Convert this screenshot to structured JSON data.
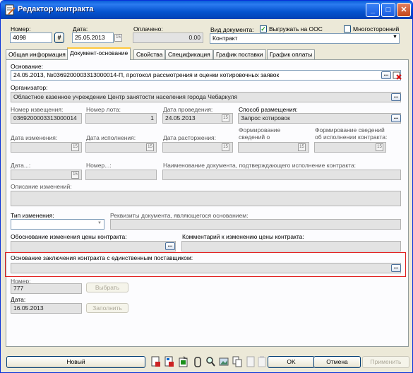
{
  "window": {
    "title": "Редактор контракта",
    "min": "_",
    "max": "□",
    "close": "✕"
  },
  "header": {
    "number_label": "Номер:",
    "number_value": "4098",
    "date_label": "Дата:",
    "date_value": "25.05.2013",
    "paid_label": "Оплачено:",
    "paid_value": "0.00",
    "doctype_label": "Вид документа:",
    "doctype_value": "Контракт",
    "upload_label": "Выгружать на ООС",
    "upload_checked": true,
    "multi_label": "Многосторонний",
    "multi_checked": false
  },
  "tabs": [
    "Общая информация",
    "Документ-основание",
    "Свойства",
    "Спецификация",
    "График поставки",
    "График оплаты"
  ],
  "active_tab": "Документ-основание",
  "form": {
    "basis_label": "Основание:",
    "basis_value": "24.05.2013, №0369200003313000014-П, протокол рассмотрения и оценки котировочных заявок",
    "organizer_label": "Организатор:",
    "organizer_value": "Областное казенное учреждение Центр занятости населения города Чебаркуля",
    "notice_label": "Номер извещения:",
    "notice_value": "0369200003313000014",
    "lot_label": "Номер лота:",
    "lot_value": "1",
    "hold_date_label": "Дата проведения:",
    "hold_date_value": "24.05.2013",
    "method_label": "Способ размещения:",
    "method_value": "Запрос котировок",
    "change_date_label": "Дата изменения:",
    "exec_date_label": "Дата исполнения:",
    "cancel_date_label": "Дата расторжения:",
    "forming_label_1": "Формирование",
    "forming_label_2": "сведений о",
    "forming_exec_label_1": "Формирование сведений",
    "forming_exec_label_2": "об исполнении контракта:",
    "date_dots_label": "Дата...:",
    "number_dots_label": "Номер...:",
    "confirm_doc_label": "Наименование документа, подтверждающего исполнение контракта:",
    "change_desc_label": "Описание изменений:",
    "change_type_label": "Тип изменения:",
    "basis_requisites_label": "Реквизиты документа, являющегося основанием:",
    "price_reason_label": "Обоснование изменения цены контракта:",
    "price_comment_label": "Комментарий к изменению цены контракта:",
    "single_supplier_label": "Основание заключения контракта с единственным поставщиком:",
    "num_label": "Номер:",
    "num_value": "777",
    "select_button": "Выбрать",
    "date2_label": "Дата:",
    "date2_value": "16.05.2013",
    "fill_button": "Заполнить"
  },
  "footer": {
    "new_button": "Новый",
    "ok_button": "OK",
    "cancel_button": "Отмена",
    "apply_button": "Применить"
  },
  "colors": {
    "title_bar": "#0553cf",
    "highlight_border": "#e02020",
    "window_bg": "#ece9d8"
  }
}
